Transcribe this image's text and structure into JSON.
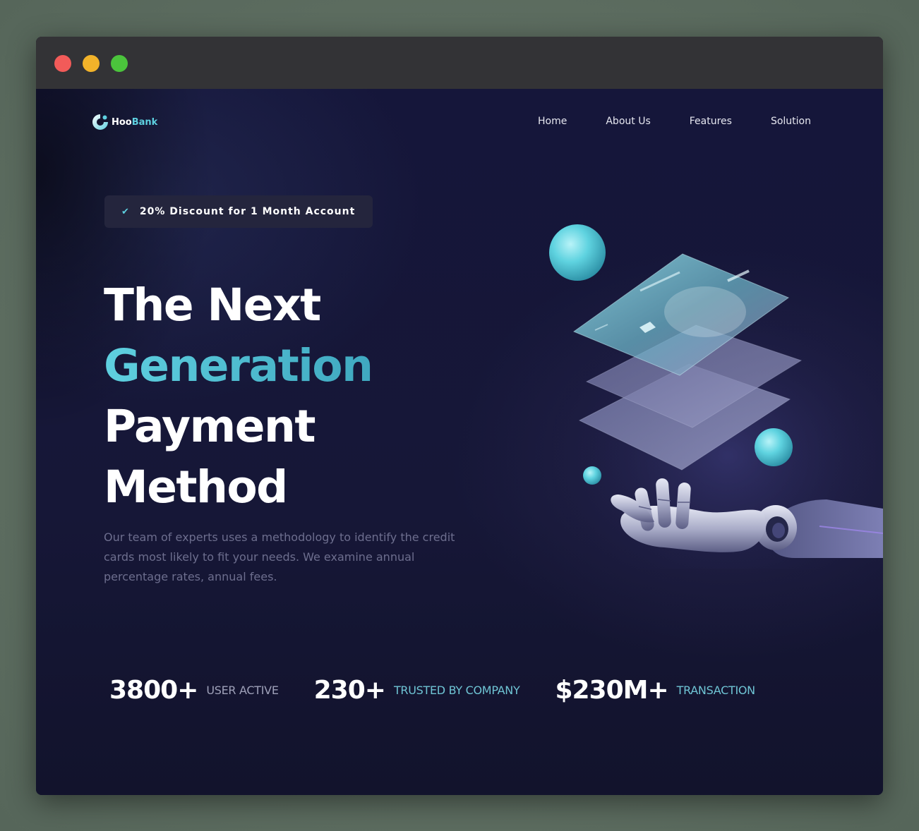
{
  "window": {
    "controls": [
      "close",
      "minimize",
      "maximize"
    ],
    "colors": {
      "close": "#f25b59",
      "minimize": "#f2b32a",
      "maximize": "#4bc43c"
    }
  },
  "brand": {
    "name_part1": "Hoo",
    "name_part2": "Bank",
    "logo_icon": "hoobank-logo-icon",
    "accent_color": "#5ed0e0"
  },
  "nav": {
    "items": [
      {
        "label": "Home"
      },
      {
        "label": "About Us"
      },
      {
        "label": "Features"
      },
      {
        "label": "Solution"
      }
    ]
  },
  "hero": {
    "badge": {
      "icon": "check-icon",
      "text": "20% Discount for 1 Month Account"
    },
    "headline": {
      "line1": "The Next",
      "line2": "Generation",
      "line3": "Payment",
      "line4": "Method"
    },
    "description": "Our team of experts uses a methodology to identify the credit cards most likely to fit your needs. We examine annual percentage rates, annual fees.",
    "illustration": "robot-hand-with-floating-cards"
  },
  "stats": [
    {
      "value": "3800+",
      "label": "USER ACTIVE"
    },
    {
      "value": "230+",
      "label": "TRUSTED BY COMPANY"
    },
    {
      "value": "$230M+",
      "label": "TRANSACTION"
    }
  ],
  "colors": {
    "background": "#15163a",
    "accent": "#5ed0e0",
    "text_muted": "#6d6e8e"
  }
}
